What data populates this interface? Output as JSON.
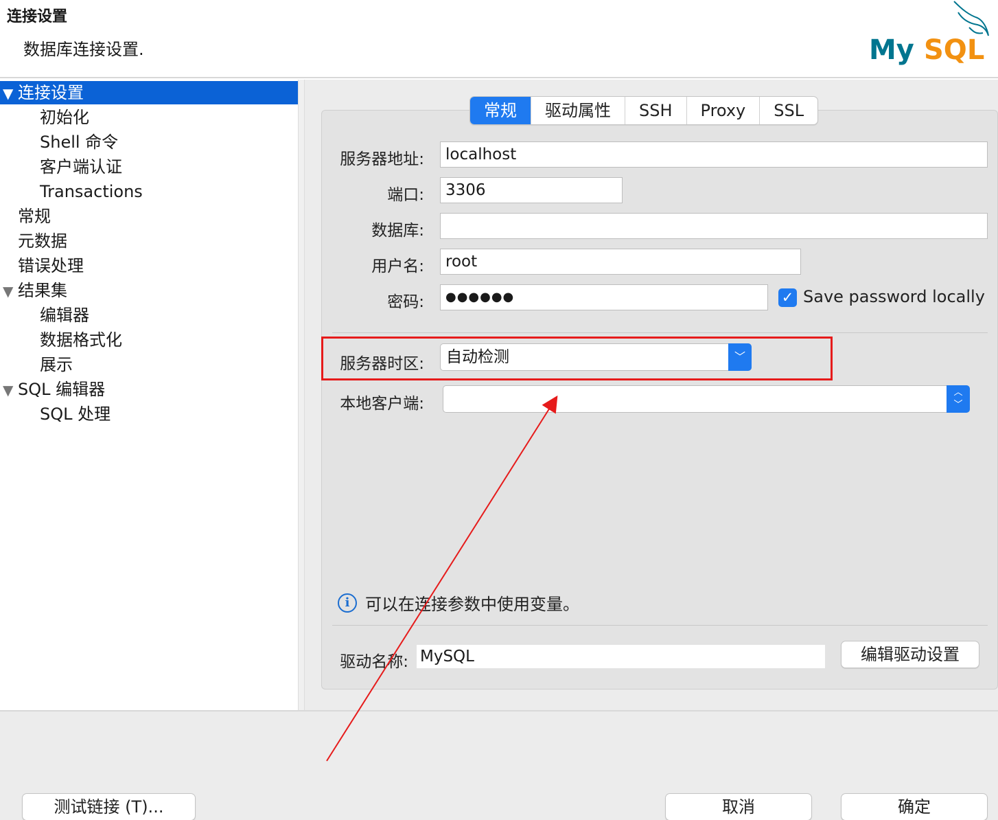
{
  "header": {
    "title": "连接设置",
    "subtitle": "数据库连接设置."
  },
  "logo": {
    "text_my": "My",
    "text_sql": "SQL",
    "color_my": "#00758f",
    "color_sql": "#f29111"
  },
  "tree": {
    "items": [
      {
        "label": "连接设置",
        "level": 0,
        "expanded": true,
        "selected": true
      },
      {
        "label": "初始化",
        "level": 1
      },
      {
        "label": "Shell 命令",
        "level": 1
      },
      {
        "label": "客户端认证",
        "level": 1
      },
      {
        "label": "Transactions",
        "level": 1
      },
      {
        "label": "常规",
        "level": 0
      },
      {
        "label": "元数据",
        "level": 0
      },
      {
        "label": "错误处理",
        "level": 0
      },
      {
        "label": "结果集",
        "level": 0,
        "expanded": true
      },
      {
        "label": "编辑器",
        "level": 1
      },
      {
        "label": "数据格式化",
        "level": 1
      },
      {
        "label": "展示",
        "level": 1
      },
      {
        "label": "SQL 编辑器",
        "level": 0,
        "expanded": true
      },
      {
        "label": "SQL 处理",
        "level": 1
      }
    ]
  },
  "tabs": [
    {
      "label": "常规",
      "active": true
    },
    {
      "label": "驱动属性"
    },
    {
      "label": "SSH"
    },
    {
      "label": "Proxy"
    },
    {
      "label": "SSL"
    }
  ],
  "form": {
    "host_label": "服务器地址:",
    "host_value": "localhost",
    "port_label": "端口:",
    "port_value": "3306",
    "database_label": "数据库:",
    "database_value": "",
    "user_label": "用户名:",
    "user_value": "root",
    "password_label": "密码:",
    "password_value": "●●●●●●",
    "save_password_label": "Save password locally",
    "save_password_checked": true,
    "timezone_label": "服务器时区:",
    "timezone_value": "自动检测",
    "local_client_label": "本地客户端:",
    "local_client_value": "",
    "info_text": "可以在连接参数中使用变量。",
    "driver_label": "驱动名称:",
    "driver_value": "MySQL",
    "edit_driver_button": "编辑驱动设置"
  },
  "footer": {
    "test_button": "测试链接 (T)...",
    "cancel_button": "取消",
    "ok_button": "确定"
  },
  "annotation_color": "#e61b1b",
  "accent_color": "#1f7af0"
}
